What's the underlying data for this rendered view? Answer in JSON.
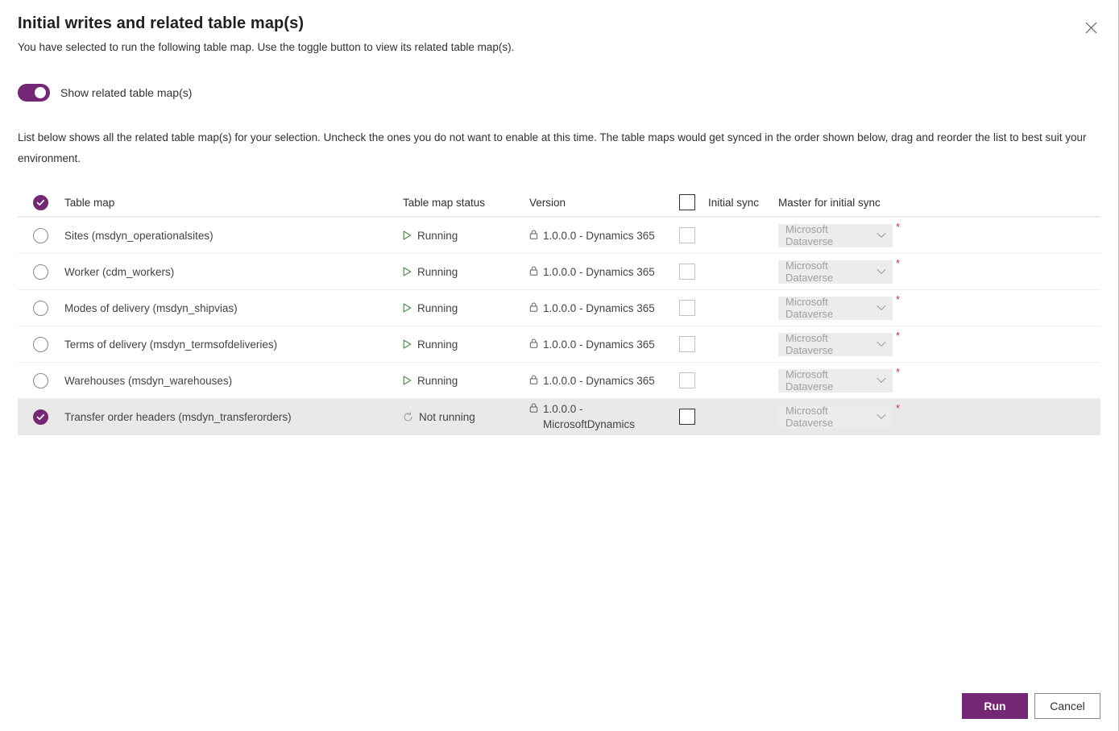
{
  "dialog": {
    "title": "Initial writes and related table map(s)",
    "subtitle": "You have selected to run the following table map. Use the toggle button to view its related table map(s).",
    "close_label": "Close",
    "description": "List below shows all the related table map(s) for your selection. Uncheck the ones you do not want to enable at this time. The table maps would get synced in the order shown below, drag and reorder the list to best suit your environment."
  },
  "toggle": {
    "label": "Show related table map(s)",
    "state": "on"
  },
  "table": {
    "headers": {
      "select_all": "select-all",
      "table_map": "Table map",
      "status": "Table map status",
      "version": "Version",
      "initial_sync": "Initial sync",
      "master": "Master for initial sync"
    },
    "rows": [
      {
        "selected": false,
        "name": "Sites (msdyn_operationalsites)",
        "status": "Running",
        "status_icon": "play-icon",
        "version": "1.0.0.0 - Dynamics 365",
        "initial_sync": false,
        "master": "Microsoft Dataverse",
        "required": "*"
      },
      {
        "selected": false,
        "name": "Worker (cdm_workers)",
        "status": "Running",
        "status_icon": "play-icon",
        "version": "1.0.0.0 - Dynamics 365",
        "initial_sync": false,
        "master": "Microsoft Dataverse",
        "required": "*"
      },
      {
        "selected": false,
        "name": "Modes of delivery (msdyn_shipvias)",
        "status": "Running",
        "status_icon": "play-icon",
        "version": "1.0.0.0 - Dynamics 365",
        "initial_sync": false,
        "master": "Microsoft Dataverse",
        "required": "*"
      },
      {
        "selected": false,
        "name": "Terms of delivery (msdyn_termsofdeliveries)",
        "status": "Running",
        "status_icon": "play-icon",
        "version": "1.0.0.0 - Dynamics 365",
        "initial_sync": false,
        "master": "Microsoft Dataverse",
        "required": "*"
      },
      {
        "selected": false,
        "name": "Warehouses (msdyn_warehouses)",
        "status": "Running",
        "status_icon": "play-icon",
        "version": "1.0.0.0 - Dynamics 365",
        "initial_sync": false,
        "master": "Microsoft Dataverse",
        "required": "*"
      },
      {
        "selected": true,
        "highlighted": true,
        "name": "Transfer order headers (msdyn_transferorders)",
        "status": "Not running",
        "status_icon": "refresh-icon",
        "version": "1.0.0.0 - MicrosoftDynamics",
        "initial_sync": false,
        "master": "Microsoft Dataverse",
        "required": "*"
      }
    ]
  },
  "footer": {
    "run_label": "Run",
    "cancel_label": "Cancel"
  },
  "colors": {
    "accent_purple": "#742774",
    "running_green": "#3c8e3c",
    "required_red": "#c4314b",
    "row_highlight": "#ebe9e7"
  }
}
